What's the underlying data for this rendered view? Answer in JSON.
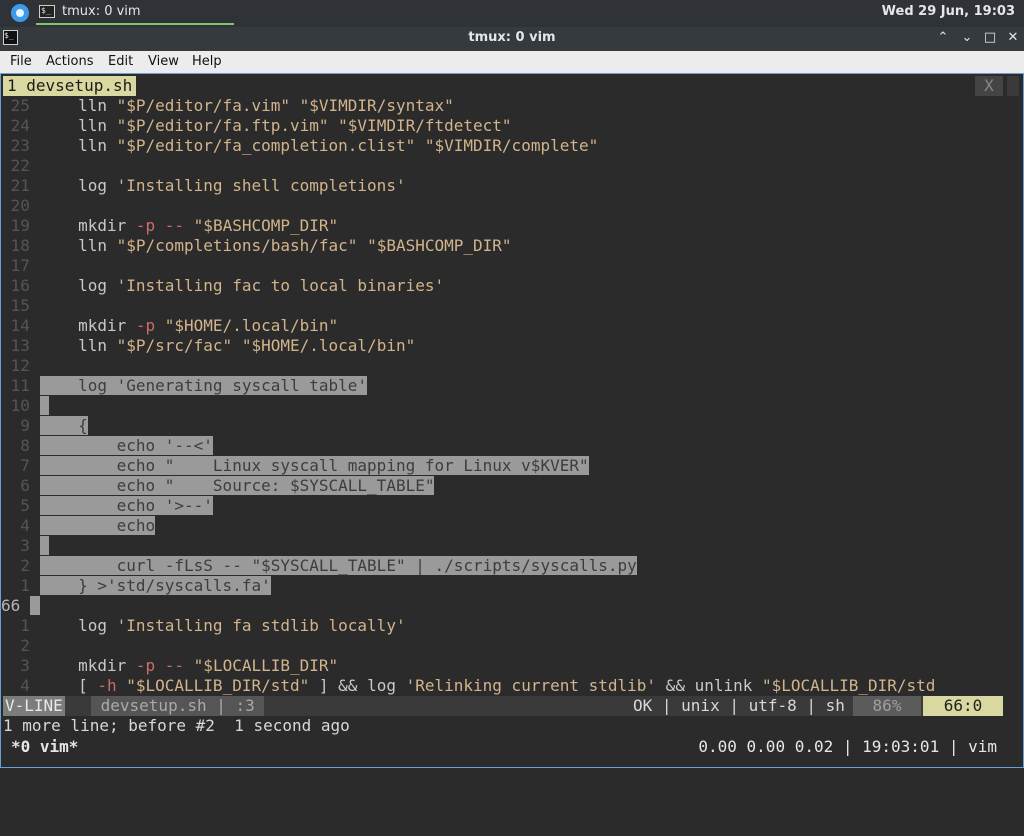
{
  "panel": {
    "task_label": "tmux: 0 vim",
    "clock": "Wed 29 Jun, 19:03",
    "accent": "#7ec86a"
  },
  "window": {
    "title": "tmux: 0 vim",
    "icon_text": "$_",
    "minimize": "⌃",
    "restore": "⌄",
    "maximize": "□",
    "close": "✕"
  },
  "menubar": [
    "File",
    "Actions",
    "Edit",
    "View",
    "Help"
  ],
  "vim": {
    "tab_label": "1 devsetup.sh",
    "tab_close": "X",
    "lines": [
      {
        "n": "25",
        "text": "    lln \"$P/editor/fa.vim\" \"$VIMDIR/syntax\""
      },
      {
        "n": "24",
        "text": "    lln \"$P/editor/fa.ftp.vim\" \"$VIMDIR/ftdetect\""
      },
      {
        "n": "23",
        "text": "    lln \"$P/editor/fa_completion.clist\" \"$VIMDIR/complete\""
      },
      {
        "n": "22",
        "text": ""
      },
      {
        "n": "21",
        "text": "    log 'Installing shell completions'"
      },
      {
        "n": "20",
        "text": ""
      },
      {
        "n": "19",
        "text": "    mkdir -p -- \"$BASHCOMP_DIR\""
      },
      {
        "n": "18",
        "text": "    lln \"$P/completions/bash/fac\" \"$BASHCOMP_DIR\""
      },
      {
        "n": "17",
        "text": ""
      },
      {
        "n": "16",
        "text": "    log 'Installing fac to local binaries'"
      },
      {
        "n": "15",
        "text": ""
      },
      {
        "n": "14",
        "text": "    mkdir -p \"$HOME/.local/bin\""
      },
      {
        "n": "13",
        "text": "    lln \"$P/src/fac\" \"$HOME/.local/bin\""
      },
      {
        "n": "12",
        "text": ""
      },
      {
        "n": "11",
        "text": "    log 'Generating syscall table'",
        "sel": true
      },
      {
        "n": "10",
        "text": "",
        "sel": true
      },
      {
        "n": " 9",
        "text": "    {",
        "sel": true
      },
      {
        "n": " 8",
        "text": "        echo '--<'",
        "sel": true
      },
      {
        "n": " 7",
        "text": "        echo \"    Linux syscall mapping for Linux v$KVER\"",
        "sel": true
      },
      {
        "n": " 6",
        "text": "        echo \"    Source: $SYSCALL_TABLE\"",
        "sel": true
      },
      {
        "n": " 5",
        "text": "        echo '>--'",
        "sel": true
      },
      {
        "n": " 4",
        "text": "        echo",
        "sel": true
      },
      {
        "n": " 3",
        "text": "",
        "sel": true
      },
      {
        "n": " 2",
        "text": "        curl -fLsS -- \"$SYSCALL_TABLE\" | ./scripts/syscalls.py",
        "sel": true
      },
      {
        "n": " 1",
        "text": "    } >'std/syscalls.fa'",
        "sel": true
      },
      {
        "n": "66",
        "text": "",
        "sel": true,
        "current": true
      },
      {
        "n": " 1",
        "text": "    log 'Installing fa stdlib locally'"
      },
      {
        "n": " 2",
        "text": ""
      },
      {
        "n": " 3",
        "text": "    mkdir -p -- \"$LOCALLIB_DIR\""
      },
      {
        "n": " 4",
        "text": "    [ -h \"$LOCALLIB_DIR/std\" ] && log 'Relinking current stdlib' && unlink \"$LOCALLIB_DIR/std"
      }
    ],
    "status": {
      "mode": "V-LINE",
      "file": " devsetup.sh | :3 ",
      "right": "OK | unix | utf-8 | sh",
      "percent": "86%",
      "position": "66:0"
    },
    "message": "1 more line; before #2  1 second ago"
  },
  "tmux": {
    "left": "*0 vim*",
    "right": "0.00 0.00 0.02 | 19:03:01 | vim"
  }
}
